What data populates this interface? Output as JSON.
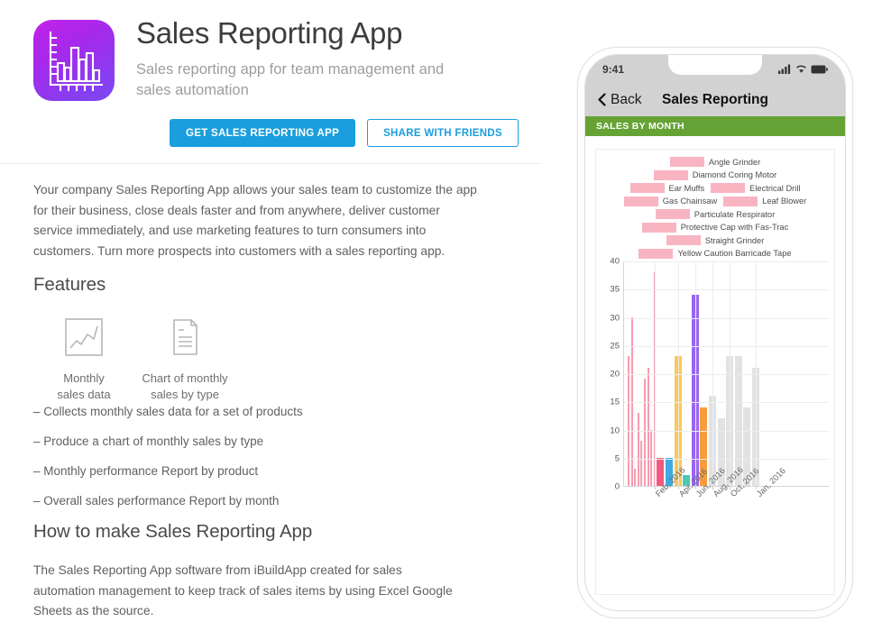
{
  "app": {
    "title": "Sales Reporting App",
    "subtitle": "Sales reporting app for team management and sales automation",
    "icon_name": "bar-chart-app-icon",
    "icon_gradient_from": "#c222e8",
    "icon_gradient_to": "#7b49f2"
  },
  "buttons": {
    "get_app": "GET SALES REPORTING APP",
    "share": "SHARE WITH FRIENDS",
    "primary_color": "#1a9edd"
  },
  "intro": "Your company Sales Reporting App allows your sales team to customize the app for their business, close deals faster and from anywhere, deliver customer service immediately, and use marketing features to turn consumers into customers. Turn more prospects into customers with a sales reporting app.",
  "features": {
    "heading": "Features",
    "items": [
      {
        "icon": "line-chart-icon",
        "label_line1": "Monthly",
        "label_line2": "sales data"
      },
      {
        "icon": "document-icon",
        "label_line1": "Chart of monthly",
        "label_line2": "sales by type"
      }
    ],
    "bullets": [
      "– Collects monthly sales data for a set of products",
      "– Produce a chart of monthly sales by type",
      "– Monthly performance Report by product",
      "– Overall sales performance Report by month"
    ]
  },
  "howto": {
    "heading": "How to make Sales Reporting App",
    "body": "The Sales Reporting App software from iBuildApp created for sales automation management to keep track of sales items by using Excel Google Sheets as the source."
  },
  "phone": {
    "status_time": "9:41",
    "status_icons": [
      "signal-icon",
      "wifi-icon",
      "battery-icon"
    ],
    "nav_back": "Back",
    "nav_title": "Sales Reporting",
    "section_header": "SALES BY MONTH",
    "section_header_color": "#66a336"
  },
  "chart_data": {
    "type": "bar",
    "title": "SALES BY MONTH",
    "xlabel": "",
    "ylabel": "",
    "ylim": [
      0,
      40
    ],
    "yticks": [
      0,
      5,
      10,
      15,
      20,
      25,
      30,
      35,
      40
    ],
    "grid": true,
    "legend_position": "top",
    "legend_swatch_color": "#f8b4c0",
    "categories": [
      "Feb, 2016",
      "Apr, 2016",
      "Jun, 2016",
      "Aug, 2016",
      "Oct, 2016",
      "Jan, 2016"
    ],
    "legend": [
      "Angle Grinder",
      "Diamond Coring Motor",
      "Ear Muffs",
      "Electrical Drill",
      "Gas Chainsaw",
      "Leaf Blower",
      "Particulate Respirator",
      "Protective Cap with Fas-Trac",
      "Straight Grinder",
      "Yellow Caution Barricade Tape"
    ],
    "bars": [
      {
        "value": 23,
        "color": "#f89bb0",
        "width": 2
      },
      {
        "value": 30,
        "color": "#f89bb0",
        "width": 2
      },
      {
        "value": 3,
        "color": "#f89bb0",
        "width": 2
      },
      {
        "value": 13,
        "color": "#f89bb0",
        "width": 2
      },
      {
        "value": 8,
        "color": "#f89bb0",
        "width": 2
      },
      {
        "value": 19,
        "color": "#f89bb0",
        "width": 2
      },
      {
        "value": 21,
        "color": "#f89bb0",
        "width": 2
      },
      {
        "value": 10,
        "color": "#f89bb0",
        "width": 2
      },
      {
        "value": 38,
        "color": "#f89bb0",
        "width": 2
      },
      {
        "value": 5,
        "color": "#f2597f",
        "width": 8
      },
      {
        "value": 5,
        "color": "#3fa9e0",
        "width": 8
      },
      {
        "value": 23,
        "color": "#fbc858",
        "width": 8
      },
      {
        "value": 2,
        "color": "#4cc8b0",
        "width": 8
      },
      {
        "value": 34,
        "color": "#9966f0",
        "width": 8
      },
      {
        "value": 14,
        "color": "#f99b3d",
        "width": 8
      },
      {
        "value": 16,
        "color": "#e2e2e2",
        "width": 8
      },
      {
        "value": 12,
        "color": "#e2e2e2",
        "width": 8
      },
      {
        "value": 23,
        "color": "#e2e2e2",
        "width": 8
      },
      {
        "value": 23,
        "color": "#e2e2e2",
        "width": 8
      },
      {
        "value": 14,
        "color": "#e2e2e2",
        "width": 8
      },
      {
        "value": 21,
        "color": "#e2e2e2",
        "width": 8
      }
    ]
  }
}
